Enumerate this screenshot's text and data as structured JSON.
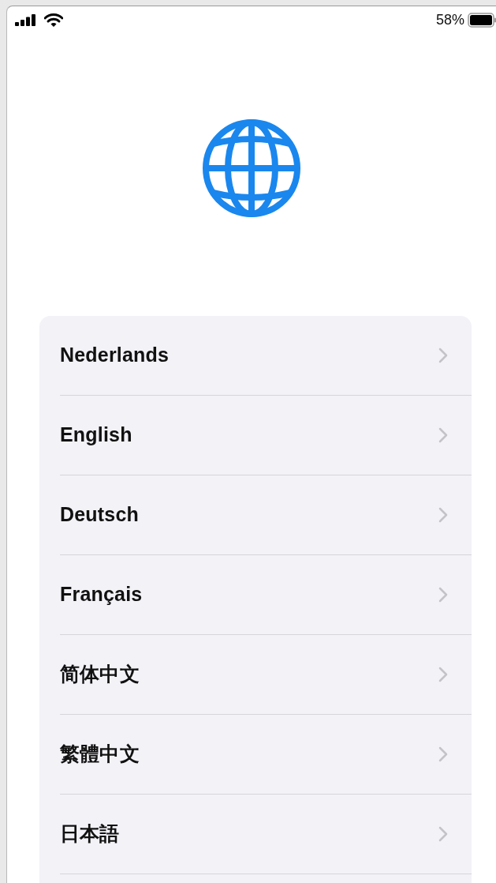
{
  "status_bar": {
    "battery_text": "58%"
  },
  "languages": [
    {
      "label": "Nederlands"
    },
    {
      "label": "English"
    },
    {
      "label": "Deutsch"
    },
    {
      "label": "Français"
    },
    {
      "label": "简体中文"
    },
    {
      "label": "繁體中文"
    },
    {
      "label": "日本語"
    }
  ]
}
